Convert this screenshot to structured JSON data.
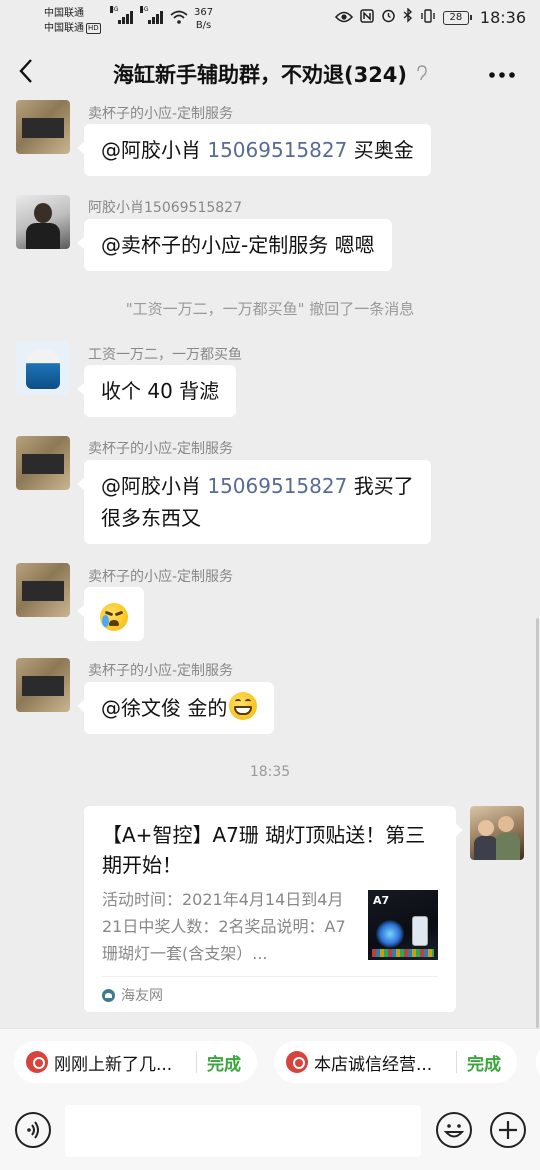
{
  "status_bar": {
    "carrier1": "中国联通",
    "carrier2": "中国联通",
    "hd": "HD",
    "sig1_tag": "3G",
    "sig2_tag": "4G",
    "net_speed_value": "367",
    "net_speed_unit": "B/s",
    "battery": "28",
    "time": "18:36"
  },
  "header": {
    "title": "海缸新手辅助群，不劝退(324)",
    "back_icon": "back-chevron-icon",
    "more_icon": "more-dots-icon"
  },
  "messages": [
    {
      "sender": "卖杯子的小应-定制服务",
      "text_prefix": "@阿胶小肖 ",
      "number": "15069515827",
      "text_suffix": "  买奥金"
    },
    {
      "sender": "阿胶小肖15069515827",
      "text": "@卖杯子的小应-定制服务  嗯嗯"
    },
    {
      "system": "\"工资一万二，一万都买鱼\" 撤回了一条消息"
    },
    {
      "sender": "工资一万二，一万都买鱼",
      "text": "收个 40 背滤"
    },
    {
      "sender": "卖杯子的小应-定制服务",
      "text_prefix": "@阿胶小肖 ",
      "number": "15069515827",
      "text_suffix": "  我买了",
      "text_line2": "很多东西又"
    },
    {
      "sender": "卖杯子的小应-定制服务",
      "emoji": "crying-face-emoji"
    },
    {
      "sender": "卖杯子的小应-定制服务",
      "text": "@徐文俊  金的",
      "emoji": "grinning-face-emoji"
    }
  ],
  "timestamp": "18:35",
  "link_card": {
    "title": "【A+智控】A7珊 瑚灯顶贴送！第三期开始！",
    "description": "活动时间：2021年4月14日到4月21日中奖人数：2名奖品说明：A7珊瑚灯一套(含支架）...",
    "thumb_label": "A7",
    "source": "海友网"
  },
  "quick_replies": [
    {
      "label": "刚刚上新了几...",
      "action": "完成"
    },
    {
      "label": "本店诚信经营...",
      "action": "完成"
    }
  ],
  "colors": {
    "background": "#ededed",
    "bubble": "#ffffff",
    "mention": "#576b95",
    "done_green": "#3aa53a"
  }
}
